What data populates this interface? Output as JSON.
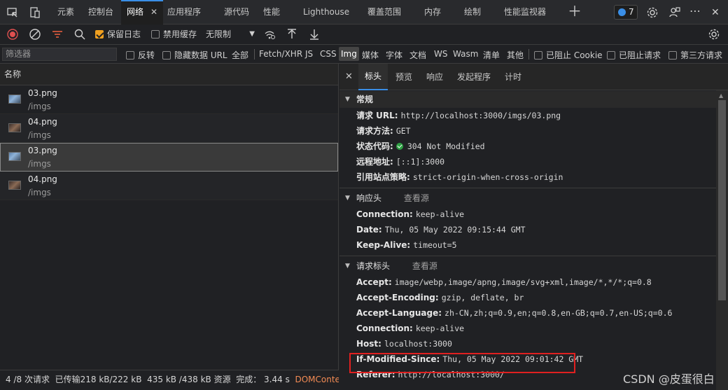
{
  "tabs": {
    "elements": "元素",
    "console": "控制台",
    "network": "网络",
    "app": "应用程序",
    "sources": "源代码",
    "performance": "性能",
    "lighthouse": "Lighthouse",
    "coverage": "覆盖范围",
    "memory": "内存",
    "rendering": "绘制",
    "perf_monitor": "性能监视器",
    "issues_count": "7"
  },
  "toolbar": {
    "preserve_log": "保留日志",
    "disable_cache": "禁用缓存",
    "throttle": "无限制"
  },
  "filterbar": {
    "placeholder": "筛选器",
    "invert": "反转",
    "hide_data_url": "隐藏数据 URL",
    "types": [
      "全部",
      "Fetch/XHR",
      "JS",
      "CSS",
      "Img",
      "媒体",
      "字体",
      "文档",
      "WS",
      "Wasm",
      "清单",
      "其他"
    ],
    "blocked_cookies": "已阻止 Cookie",
    "blocked_requests": "已阻止请求",
    "third_party": "第三方请求"
  },
  "requests": {
    "column_name": "名称",
    "rows": [
      {
        "name": "03.png",
        "path": "/imgs"
      },
      {
        "name": "04.png",
        "path": "/imgs"
      },
      {
        "name": "03.png",
        "path": "/imgs"
      },
      {
        "name": "04.png",
        "path": "/imgs"
      }
    ]
  },
  "status": {
    "requests": "4 /8 次请求",
    "transferred": "已传输218 kB/222 kB",
    "resources": "435 kB /438 kB 资源",
    "finish": "完成： 3.44 s",
    "dcl": "DOMContentLoade"
  },
  "detail": {
    "tabs": [
      "标头",
      "预览",
      "响应",
      "发起程序",
      "计时"
    ],
    "general": {
      "title": "常规",
      "request_url_k": "请求 URL:",
      "request_url_v": "http://localhost:3000/imgs/03.png",
      "method_k": "请求方法:",
      "method_v": "GET",
      "status_k": "状态代码:",
      "status_v": "304 Not Modified",
      "remote_k": "远程地址:",
      "remote_v": "[::1]:3000",
      "referrer_k": "引用站点策略:",
      "referrer_v": "strict-origin-when-cross-origin"
    },
    "response": {
      "title": "响应头",
      "view_source": "查看源",
      "items": [
        {
          "k": "Connection:",
          "v": "keep-alive"
        },
        {
          "k": "Date:",
          "v": "Thu, 05 May 2022 09:15:44 GMT"
        },
        {
          "k": "Keep-Alive:",
          "v": "timeout=5"
        }
      ]
    },
    "request": {
      "title": "请求标头",
      "view_source": "查看源",
      "items": [
        {
          "k": "Accept:",
          "v": "image/webp,image/apng,image/svg+xml,image/*,*/*;q=0.8"
        },
        {
          "k": "Accept-Encoding:",
          "v": "gzip, deflate, br"
        },
        {
          "k": "Accept-Language:",
          "v": "zh-CN,zh;q=0.9,en;q=0.8,en-GB;q=0.7,en-US;q=0.6"
        },
        {
          "k": "Connection:",
          "v": "keep-alive"
        },
        {
          "k": "Host:",
          "v": "localhost:3000"
        },
        {
          "k": "If-Modified-Since:",
          "v": "Thu, 05 May 2022 09:01:42 GMT"
        },
        {
          "k": "Referer:",
          "v": "http://localhost:3000/"
        }
      ]
    }
  },
  "watermark": "CSDN @皮蛋很白"
}
